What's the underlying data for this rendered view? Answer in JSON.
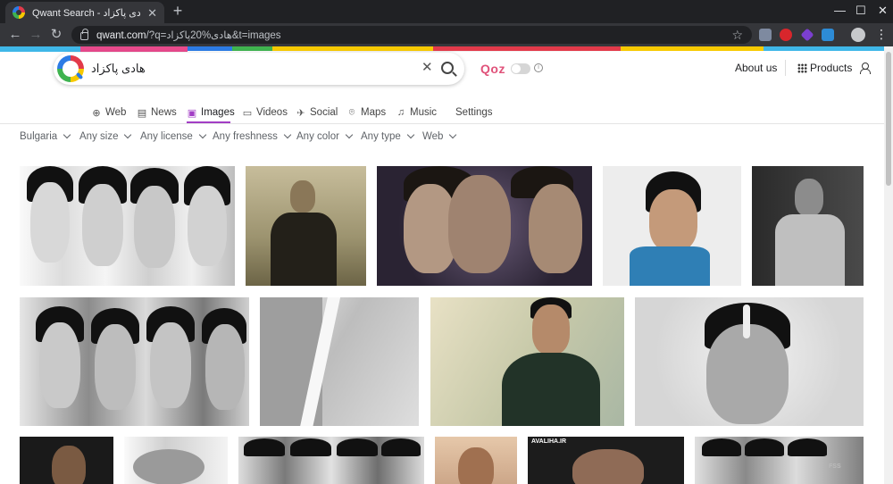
{
  "browser": {
    "tab_title": "Qwant Search - هادی پاکزاد",
    "url_domain": "qwant.com",
    "url_rest": "/?q=هادی%20پاکزاد&t=images",
    "new_tab": "+",
    "close_tab": "✕",
    "win_min": "—",
    "win_max": "☐",
    "win_close": "✕",
    "back": "←",
    "forward": "→",
    "reload": "↻",
    "star": "☆",
    "menu": "⋮"
  },
  "header": {
    "query": "هادی پاکزاد",
    "clear": "✕",
    "qoz_label": "Qoz",
    "info": "i",
    "about_label": "About us",
    "products_label": "Products"
  },
  "tabs": [
    {
      "label": "Web",
      "icon": "globe-icon",
      "glyph": "⊕"
    },
    {
      "label": "News",
      "icon": "news-icon",
      "glyph": "▤"
    },
    {
      "label": "Images",
      "icon": "image-icon",
      "glyph": "▣",
      "active": true
    },
    {
      "label": "Videos",
      "icon": "video-icon",
      "glyph": "▭"
    },
    {
      "label": "Social",
      "icon": "bird-icon",
      "glyph": "✈"
    },
    {
      "label": "Maps",
      "icon": "map-pin-icon",
      "glyph": "⌾"
    },
    {
      "label": "Music",
      "icon": "music-icon",
      "glyph": "♫"
    },
    {
      "label": "Settings",
      "icon": "",
      "glyph": ""
    }
  ],
  "filters": [
    {
      "label": "Bulgaria"
    },
    {
      "label": "Any size"
    },
    {
      "label": "Any license"
    },
    {
      "label": "Any freshness"
    },
    {
      "label": "Any color"
    },
    {
      "label": "Any type"
    },
    {
      "label": "Web"
    }
  ],
  "watermarks": {
    "avaliha": "AVALIHA.IR",
    "bottom_right": "FSS"
  },
  "colors": {
    "accent": "#a23ec5",
    "qoz": "#e0527a"
  }
}
